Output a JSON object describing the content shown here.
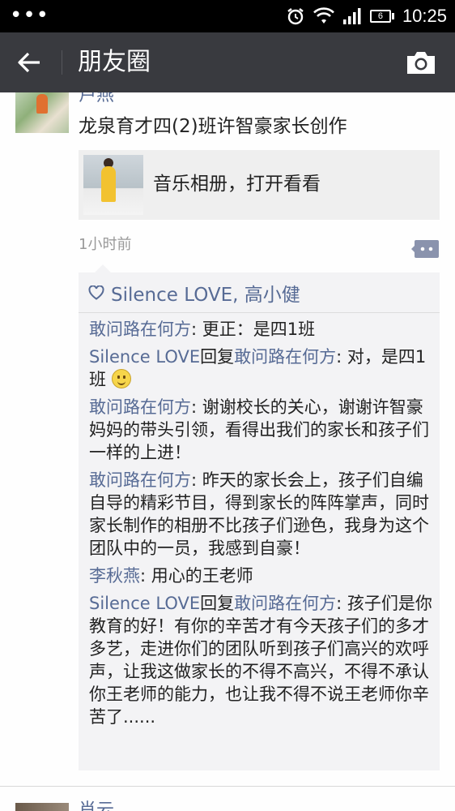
{
  "statusbar": {
    "time": "10:25",
    "battery": "6",
    "overflow": "•••"
  },
  "appbar": {
    "title": "朋友圈"
  },
  "post": {
    "name": "卢燕",
    "text": "龙泉育才四(2)班许智豪家长创作",
    "share_title": "音乐相册，打开看看",
    "time": "1小时前",
    "likes": "Silence LOVE, 高小健",
    "comments": [
      {
        "name": "敢问路在何方",
        "body": ": 更正：是四1班"
      },
      {
        "name": "Silence LOVE",
        "reply_word": "回复",
        "to": "敢问路在何方",
        "body": ": 对，是四1班",
        "emoji": "smile-emoji"
      },
      {
        "name": "敢问路在何方",
        "body": ": 谢谢校长的关心，谢谢许智豪妈妈的带头引领，看得出我们的家长和孩子们一样的上进！"
      },
      {
        "name": "敢问路在何方",
        "body": ": 昨天的家长会上，孩子们自编自导的精彩节目，得到家长的阵阵掌声，同时家长制作的相册不比孩子们逊色，我身为这个团队中的一员，我感到自豪！"
      },
      {
        "name": "李秋燕",
        "body": ": 用心的王老师"
      },
      {
        "name": "Silence LOVE",
        "reply_word": "回复",
        "to": "敢问路在何方",
        "body": ": 孩子们是你教育的好！有你的辛苦才有今天孩子们的多才多艺，走进你们的团队听到孩子们高兴的欢呼声，让我这做家长的不得不高兴，不得不承认你王老师的能力，也让我不得不说王老师你辛苦了......"
      }
    ]
  },
  "next_post": {
    "name": "肖云"
  },
  "colors": {
    "appbar": "#393a3f",
    "link": "#576b95",
    "statusbar": "#000000"
  }
}
